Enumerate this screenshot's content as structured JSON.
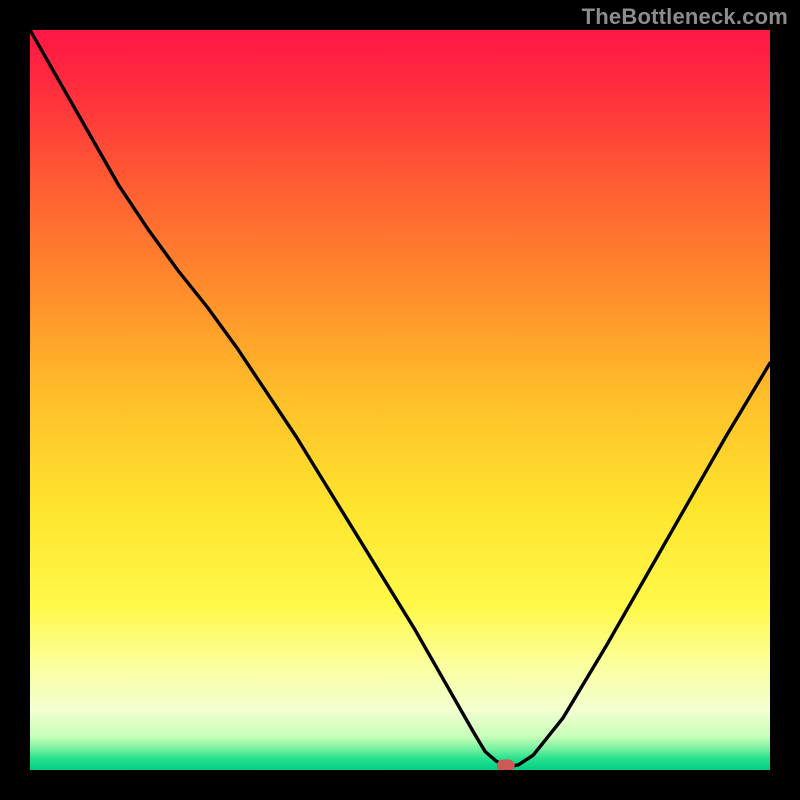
{
  "watermark": "TheBottleneck.com",
  "chart_data": {
    "type": "line",
    "title": "",
    "xlabel": "",
    "ylabel": "",
    "xlim": [
      0,
      100
    ],
    "ylim": [
      0,
      100
    ],
    "gradient_stops": [
      {
        "offset": 0.0,
        "color": "#ff1744"
      },
      {
        "offset": 0.07,
        "color": "#ff2a3f"
      },
      {
        "offset": 0.2,
        "color": "#ff5a33"
      },
      {
        "offset": 0.35,
        "color": "#ff8c2c"
      },
      {
        "offset": 0.5,
        "color": "#ffc02a"
      },
      {
        "offset": 0.65,
        "color": "#ffe52e"
      },
      {
        "offset": 0.78,
        "color": "#fff94a"
      },
      {
        "offset": 0.86,
        "color": "#fbffa0"
      },
      {
        "offset": 0.92,
        "color": "#f1ffd0"
      },
      {
        "offset": 0.955,
        "color": "#c8ffb8"
      },
      {
        "offset": 0.972,
        "color": "#73f0a0"
      },
      {
        "offset": 0.985,
        "color": "#26e08e"
      },
      {
        "offset": 1.0,
        "color": "#00d084"
      }
    ],
    "series": [
      {
        "name": "bottleneck-curve",
        "x": [
          0,
          4,
          8,
          12,
          16,
          20,
          24,
          28,
          32,
          36,
          40,
          44,
          48,
          52,
          56,
          58,
          60,
          61.5,
          63,
          64,
          65,
          66,
          68,
          72,
          78,
          86,
          94,
          100
        ],
        "y": [
          100,
          93,
          86,
          79,
          73,
          67.5,
          62.5,
          57,
          51,
          45,
          38.5,
          32,
          25.5,
          19,
          12,
          8.5,
          5,
          2.5,
          1.2,
          0.7,
          0.5,
          0.7,
          2,
          7,
          17,
          31,
          45,
          55
        ]
      }
    ],
    "marker": {
      "x": 64.3,
      "y": 0.6,
      "color": "#cc5a57"
    }
  }
}
